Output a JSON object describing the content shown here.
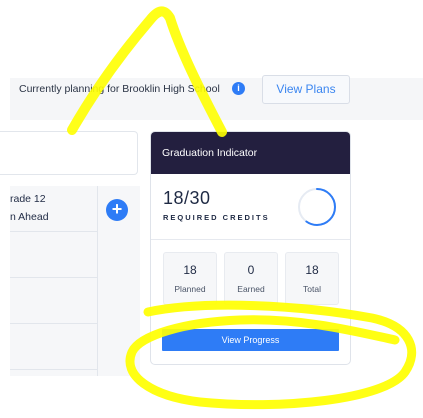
{
  "header": {
    "planning_text": "Currently planning for Brooklin High School",
    "info_icon": "info-icon",
    "view_plans_label": "View Plans"
  },
  "planner": {
    "grade_title": "rade 12",
    "grade_subtitle": "n Ahead",
    "add_icon": "plus-circle-icon"
  },
  "graduation": {
    "title": "Graduation Indicator",
    "credits": "18/30",
    "credits_label": "REQUIRED CREDITS",
    "progress_fraction": 0.6,
    "stats": [
      {
        "value": "18",
        "label": "Planned"
      },
      {
        "value": "0",
        "label": "Earned"
      },
      {
        "value": "18",
        "label": "Total"
      }
    ],
    "view_progress_label": "View Progress"
  },
  "colors": {
    "accent_blue": "#2e7cf6",
    "header_dark": "#231f3f",
    "annotation_yellow": "#ffff00"
  }
}
